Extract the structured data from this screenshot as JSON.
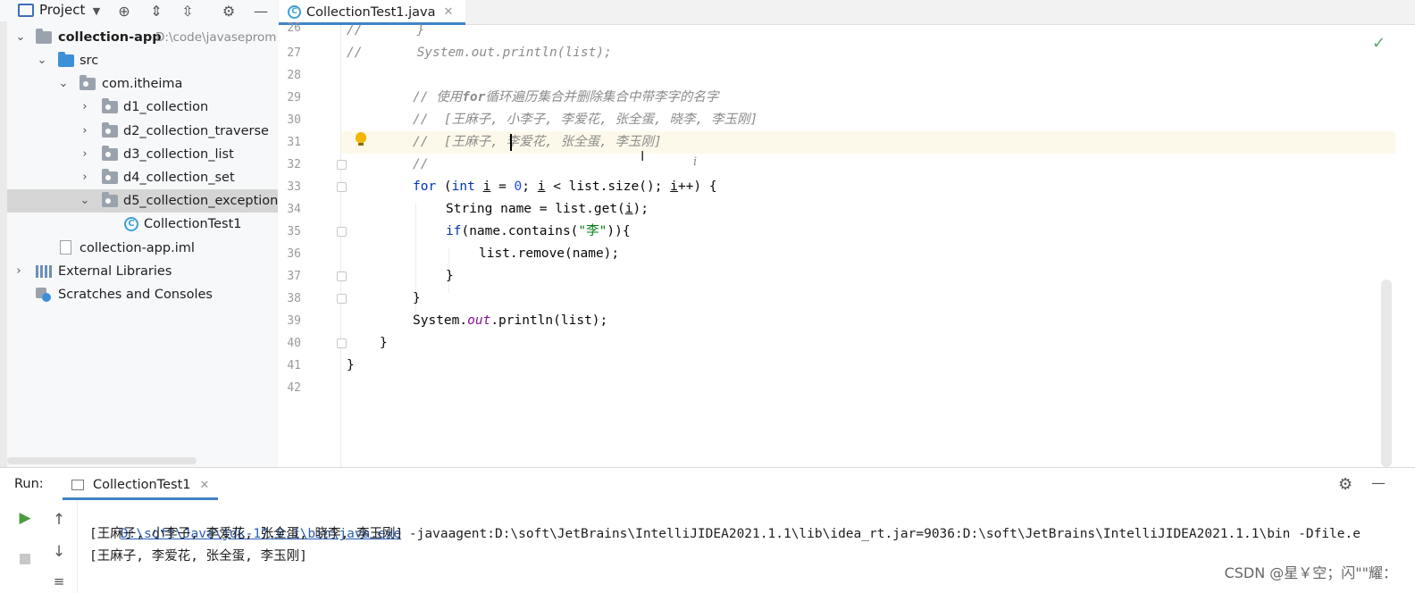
{
  "project_panel": {
    "title": "Project",
    "tree": [
      {
        "label": "collection-app",
        "path": "D:\\code\\javaseprom",
        "bold": true
      },
      {
        "label": "src"
      },
      {
        "label": "com.itheima"
      },
      {
        "label": "d1_collection"
      },
      {
        "label": "d2_collection_traverse"
      },
      {
        "label": "d3_collection_list"
      },
      {
        "label": "d4_collection_set"
      },
      {
        "label": "d5_collection_exception",
        "selected": true
      },
      {
        "label": "CollectionTest1"
      },
      {
        "label": "collection-app.iml"
      },
      {
        "label": "External Libraries"
      },
      {
        "label": "Scratches and Consoles"
      }
    ]
  },
  "editor": {
    "tab_label": "CollectionTest1.java",
    "current_line": 31,
    "lines": [
      {
        "n": "26",
        "text": "//        }"
      },
      {
        "n": "27",
        "text": "//        System.out.println(list);"
      },
      {
        "n": "28",
        "text": ""
      },
      {
        "n": "29",
        "text": "// 使用for循环遍历集合并删除集合中带李字的名字"
      },
      {
        "n": "30",
        "text": "//  [王麻子, 小李子, 李爱花, 张全蛋, 晓李, 李玉刚]"
      },
      {
        "n": "31",
        "text": "//  [王麻子, 李爱花, 张全蛋, 李玉刚]"
      },
      {
        "n": "32",
        "text": "//"
      },
      {
        "n": "33",
        "text": "for (int i = 0; i < list.size(); i++) {"
      },
      {
        "n": "34",
        "text": "String name = list.get(i);"
      },
      {
        "n": "35",
        "text": "if(name.contains(\"李\")){"
      },
      {
        "n": "36",
        "text": "list.remove(name);"
      },
      {
        "n": "37",
        "text": "}"
      },
      {
        "n": "38",
        "text": "}"
      },
      {
        "n": "39",
        "text": "System.out.println(list);"
      },
      {
        "n": "40",
        "text": "}"
      },
      {
        "n": "41",
        "text": "}"
      },
      {
        "n": "42",
        "text": ""
      }
    ]
  },
  "run_panel": {
    "label": "Run:",
    "tab_label": "CollectionTest1",
    "command_path": "D:\\soft\\Java\\jdk-17.0.1\\bin\\java.exe",
    "command_args": " -javaagent:D:\\soft\\JetBrains\\IntelliJIDEA2021.1.1\\lib\\idea_rt.jar=9036:D:\\soft\\JetBrains\\IntelliJIDEA2021.1.1\\bin -Dfile.e",
    "output": [
      "[王麻子, 小李子, 李爱花, 张全蛋, 晓李, 李玉刚]",
      "[王麻子, 李爱花, 张全蛋, 李玉刚]"
    ]
  },
  "watermark": "CSDN @星￥空；闪\"\"耀：",
  "icons": [
    "project-icon",
    "chevron-down-icon",
    "target-icon",
    "expand-all-icon",
    "collapse-all-icon",
    "gear-icon",
    "minimize-icon",
    "java-class-icon",
    "close-icon",
    "bulb-icon",
    "check-icon",
    "run-icon",
    "stop-icon",
    "arrow-up-icon",
    "arrow-down-icon"
  ],
  "colors": {
    "accent": "#4083c9",
    "keyword": "#0033b3",
    "string": "#067d17",
    "comment": "#8c8c8c"
  }
}
